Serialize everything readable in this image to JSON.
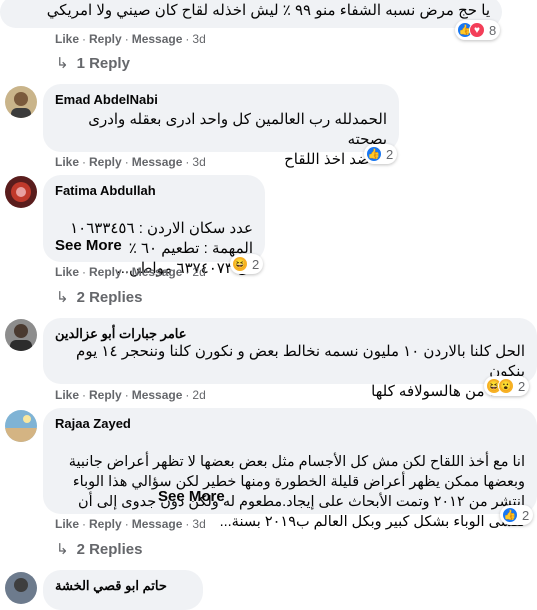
{
  "comments": [
    {
      "text": "يا حج مرض نسبه الشفاء منو ٩٩ ٪ ليش اخذله لقاح كان صيني ولا امريكي",
      "actions": {
        "like": "Like",
        "reply": "Reply",
        "message": "Message",
        "time": "3d"
      },
      "reaction_count": "8",
      "replies": "1 Reply"
    },
    {
      "author": "Emad AbdelNabi",
      "text": "الحمدلله رب العالمين كل واحد ادرى بعقله وادرى بصحته\nانا ضد اخذ اللقاح",
      "actions": {
        "like": "Like",
        "reply": "Reply",
        "message": "Message",
        "time": "3d"
      },
      "reaction_count": "2"
    },
    {
      "author": "Fatima Abdullah",
      "text": "عدد سكان الاردن : ١٠٦٣٣٤٥٦\nالمهمة : تطعيم ٦٠ ٪\nاى ٦٣٧٤٠٧٣ مواطن...",
      "see_more": "See More",
      "actions": {
        "like": "Like",
        "reply": "Reply",
        "message": "Message",
        "time": "2d"
      },
      "reaction_count": "2",
      "replies": "2 Replies"
    },
    {
      "author": "عامر جبارات أبو عزالدين",
      "text": "الحل كلنا بالاردن ١٠ مليون نسمه نخالط بعض و نكورن كلنا وننحجر ١٤ يوم بنكون\nخلصنا من هالسولافه كلها",
      "actions": {
        "like": "Like",
        "reply": "Reply",
        "message": "Message",
        "time": "2d"
      },
      "reaction_count": "2"
    },
    {
      "author": "Rajaa Zayed",
      "text": "انا مع أخذ اللقاح لكن مش كل الأجسام مثل بعض بعضها لا تظهر أعراض جانبية\nوبعضها ممكن يظهر أعراض قليلة الخطورة ومنها خطير لكن سؤالي هذا الوباء\nانتشر من ٢٠١٢ وتمت الأبحاث على إيجاد.مطعوم له ولكن دون جدوى إلى أن\nتفشى الوباء بشكل كبير وبكل العالم ب٢٠١٩ بسنة...",
      "see_more": "See More",
      "actions": {
        "like": "Like",
        "reply": "Reply",
        "message": "Message",
        "time": "3d"
      },
      "reaction_count": "2",
      "replies": "2 Replies"
    },
    {
      "author": "حاتم ابو قصي الخشة"
    }
  ],
  "icons": {
    "like": "like-reaction-icon",
    "love": "love-reaction-icon",
    "haha": "haha-reaction-icon"
  },
  "colors": {
    "bubble": "#f0f2f5",
    "meta": "#65676b",
    "like_blue": "#1877f2"
  }
}
